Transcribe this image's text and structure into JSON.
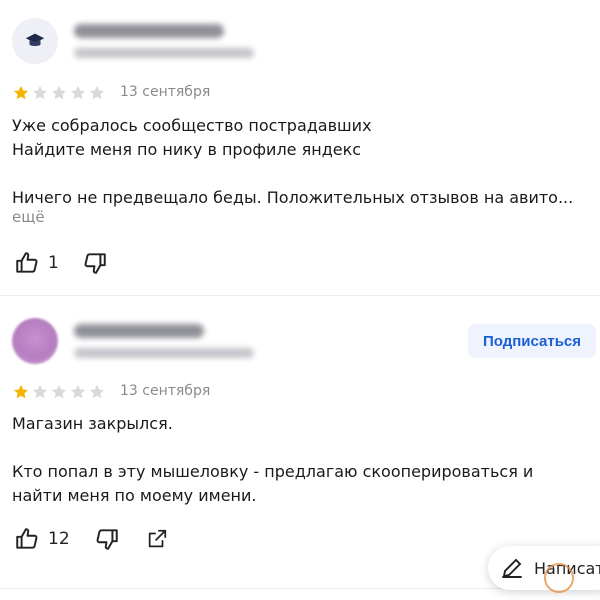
{
  "reviews": [
    {
      "rating": 1,
      "max_rating": 5,
      "date": "13 сентября",
      "text": "Уже собралось сообщество пострадавших\nНайдите меня по нику в профиле яндекс\n\nНичего не предвещало беды. Положительных отзывов на авито...",
      "more_label": "ещё",
      "likes": "1"
    },
    {
      "rating": 1,
      "max_rating": 5,
      "date": "13 сентября",
      "subscribe_label": "Подписаться",
      "text": "Магазин закрылся.\n\nКто попал в эту мышеловку - предлагаю скооперироваться и\nнайти меня по моему имени.",
      "likes": "12"
    }
  ],
  "write_button_label": "Написат",
  "colors": {
    "star_active": "#f5b400",
    "star_inactive": "#d9d9d9",
    "accent": "#1a5fd6"
  },
  "icons": [
    "thumb-up-icon",
    "thumb-down-icon",
    "share-icon",
    "pencil-icon",
    "star-icon"
  ]
}
